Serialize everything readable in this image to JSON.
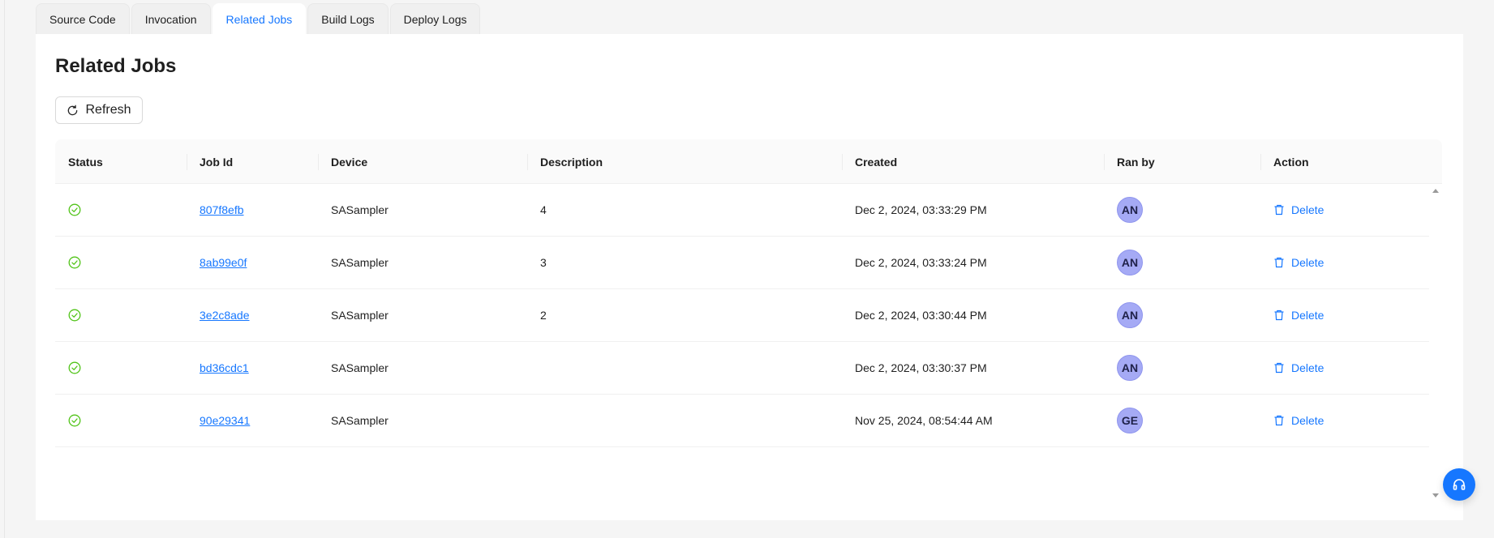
{
  "tabs": [
    {
      "label": "Source Code",
      "active": false
    },
    {
      "label": "Invocation",
      "active": false
    },
    {
      "label": "Related Jobs",
      "active": true
    },
    {
      "label": "Build Logs",
      "active": false
    },
    {
      "label": "Deploy Logs",
      "active": false
    }
  ],
  "page": {
    "title": "Related Jobs",
    "refresh_label": "Refresh"
  },
  "table": {
    "columns": [
      "Status",
      "Job Id",
      "Device",
      "Description",
      "Created",
      "Ran by",
      "Action"
    ],
    "rows": [
      {
        "status": "success",
        "job_id": "807f8efb",
        "device": "SASampler",
        "description": "4",
        "created": "Dec 2, 2024, 03:33:29 PM",
        "ran_by": "AN",
        "action": "Delete"
      },
      {
        "status": "success",
        "job_id": "8ab99e0f",
        "device": "SASampler",
        "description": "3",
        "created": "Dec 2, 2024, 03:33:24 PM",
        "ran_by": "AN",
        "action": "Delete"
      },
      {
        "status": "success",
        "job_id": "3e2c8ade",
        "device": "SASampler",
        "description": "2",
        "created": "Dec 2, 2024, 03:30:44 PM",
        "ran_by": "AN",
        "action": "Delete"
      },
      {
        "status": "success",
        "job_id": "bd36cdc1",
        "device": "SASampler",
        "description": "",
        "created": "Dec 2, 2024, 03:30:37 PM",
        "ran_by": "AN",
        "action": "Delete"
      },
      {
        "status": "success",
        "job_id": "90e29341",
        "device": "SASampler",
        "description": "",
        "created": "Nov 25, 2024, 08:54:44 AM",
        "ran_by": "GE",
        "action": "Delete"
      }
    ]
  },
  "icons": {
    "refresh": "reload-icon",
    "status": "check-circle-icon",
    "delete": "trash-icon",
    "support": "headset-icon"
  },
  "colors": {
    "accent": "#1677ff",
    "success": "#52c41a",
    "avatar_bg": "#a5aaf5"
  }
}
